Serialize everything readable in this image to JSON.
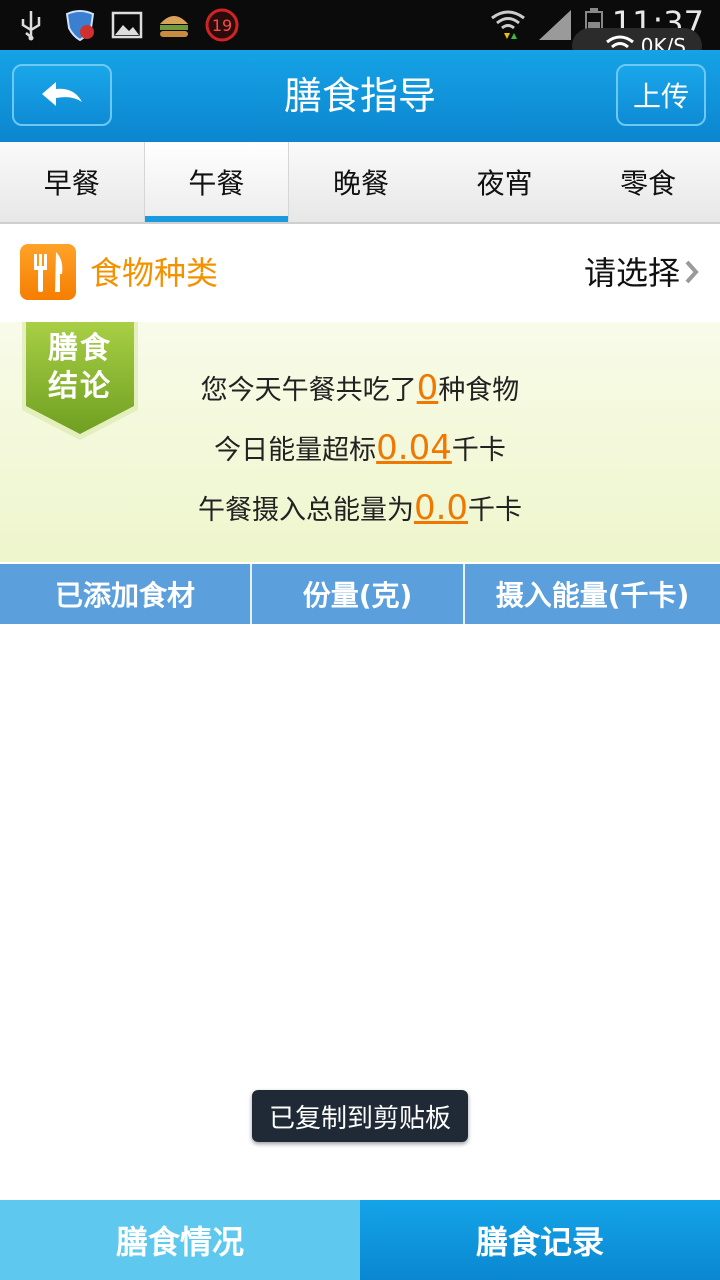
{
  "status_bar": {
    "time": "11:37",
    "net_speed": "0K/S",
    "notification_count": "19",
    "icons": [
      "usb-icon",
      "shield-icon",
      "gallery-icon",
      "burger-icon",
      "badge-19-icon",
      "wifi-icon",
      "signal-icon",
      "battery-icon"
    ]
  },
  "header": {
    "title": "膳食指导",
    "back_icon": "back-arrow-icon",
    "upload_label": "上传"
  },
  "meal_tabs": [
    {
      "label": "早餐",
      "active": false
    },
    {
      "label": "午餐",
      "active": true
    },
    {
      "label": "晚餐",
      "active": false
    },
    {
      "label": "夜宵",
      "active": false
    },
    {
      "label": "零食",
      "active": false
    }
  ],
  "food_type": {
    "label": "食物种类",
    "select_label": "请选择",
    "icon": "fork-knife-icon"
  },
  "conclusion": {
    "badge_line1": "膳食",
    "badge_line2": "结论",
    "line1_prefix": "您今天午餐共吃了",
    "food_count": "0",
    "line1_suffix": "种食物",
    "line2_prefix": "今日能量超标",
    "energy_over": "0.04",
    "line2_suffix": "千卡",
    "line3_prefix": "午餐摄入总能量为",
    "total_energy": "0.0",
    "line3_suffix": "千卡"
  },
  "table": {
    "headers": [
      "已添加食材",
      "份量(克)",
      "摄入能量(千卡)"
    ],
    "rows": []
  },
  "toast": "已复制到剪贴板",
  "bottom_tabs": [
    {
      "label": "膳食情况"
    },
    {
      "label": "膳食记录"
    }
  ],
  "colors": {
    "header_blue": "#0b86cf",
    "orange_accent": "#f39200",
    "table_header": "#5b9fdc",
    "conclusion_bg": "#eef6cc"
  }
}
